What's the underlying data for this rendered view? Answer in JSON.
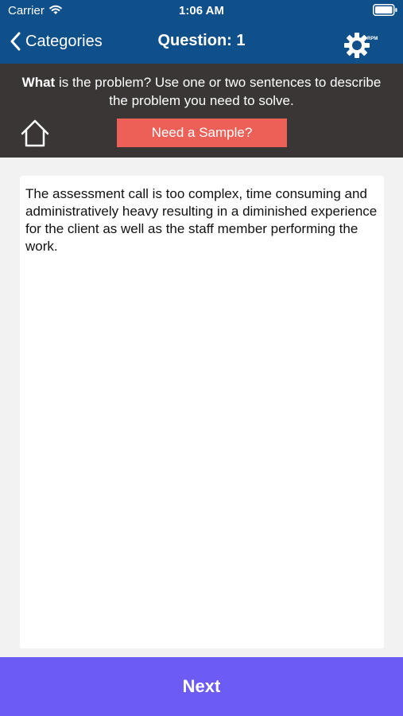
{
  "status_bar": {
    "carrier": "Carrier",
    "time": "1:06 AM",
    "icons": [
      "wifi-icon",
      "battery-icon"
    ]
  },
  "nav": {
    "back_label": "Categories",
    "title": "Question: 1",
    "settings_icon": "gear-icon",
    "settings_logo_text": "RPM",
    "back_icon": "chevron-left-icon"
  },
  "prompt": {
    "bold_lead": "What",
    "text": " is the problem? Use one or two sentences to describe the problem you need to solve.",
    "home_icon": "home-icon",
    "sample_label": "Need a Sample?"
  },
  "answer": {
    "value": "The assessment call is too complex, time consuming and administratively heavy resulting in a diminished experience for the client as well as the staff member performing the work."
  },
  "footer": {
    "next_label": "Next"
  },
  "colors": {
    "nav_background": "#0f4f8a",
    "prompt_background": "#3a3636",
    "sample_button": "#ec6058",
    "next_button": "#6c5cf5",
    "page_background": "#f2f2f2"
  }
}
